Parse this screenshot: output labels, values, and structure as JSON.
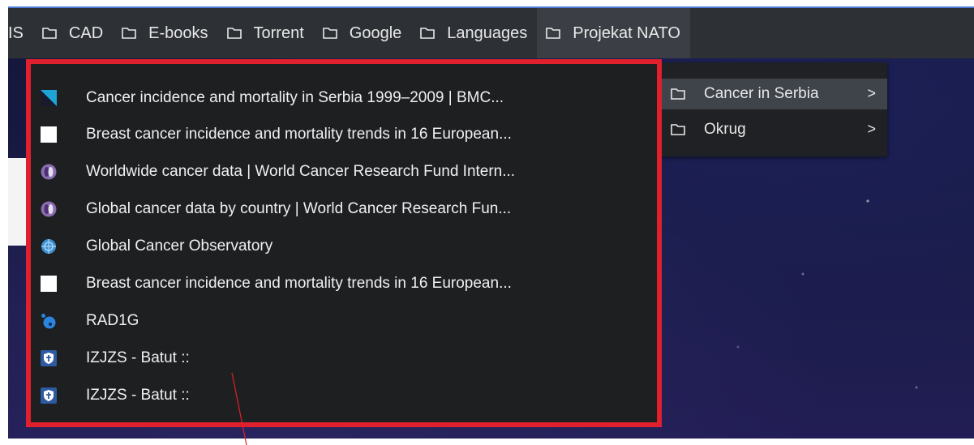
{
  "bookmarks_bar": {
    "partial_label": "IS",
    "items": [
      {
        "label": "CAD"
      },
      {
        "label": "E-books"
      },
      {
        "label": "Torrent"
      },
      {
        "label": "Google"
      },
      {
        "label": "Languages"
      },
      {
        "label": "Projekat NATO"
      }
    ]
  },
  "submenu": {
    "items": [
      {
        "label": "Cancer in Serbia",
        "chevron": ">"
      },
      {
        "label": "Okrug",
        "chevron": ">"
      }
    ]
  },
  "dropdown": {
    "items": [
      {
        "label": "Cancer incidence and mortality in Serbia 1999–2009 | BMC...",
        "favicon": "bmc-icon"
      },
      {
        "label": "Breast cancer incidence and mortality trends in 16 European...",
        "favicon": "blank-page-icon"
      },
      {
        "label": "Worldwide cancer data | World Cancer Research Fund Intern...",
        "favicon": "wcrf-icon"
      },
      {
        "label": "Global cancer data by country | World Cancer Research Fun...",
        "favicon": "wcrf-icon"
      },
      {
        "label": "Global Cancer Observatory",
        "favicon": "who-globe-icon"
      },
      {
        "label": "Breast cancer incidence and mortality trends in 16 European...",
        "favicon": "blank-page-icon"
      },
      {
        "label": "RAD1G",
        "favicon": "rad1g-icon"
      },
      {
        "label": "IZJZS - Batut ::",
        "favicon": "batut-shield-icon"
      },
      {
        "label": "IZJZS - Batut ::",
        "favicon": "batut-shield-icon"
      }
    ]
  },
  "colors": {
    "highlight_border": "#e0202c",
    "menu_background": "#1d1f21",
    "bar_background": "#2d3035"
  }
}
